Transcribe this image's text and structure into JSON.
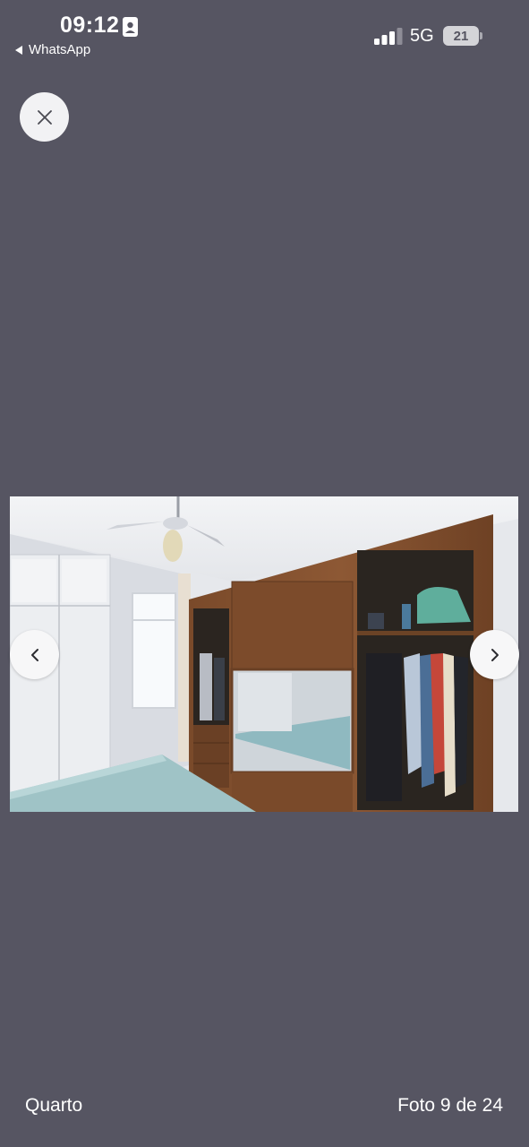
{
  "status_bar": {
    "time": "09:12",
    "back_app": "WhatsApp",
    "network": "5G",
    "battery": "21"
  },
  "icons": {
    "id_card": "contact-card-icon",
    "back": "back-triangle-icon",
    "signal": "cellular-signal-icon",
    "close": "close-icon",
    "prev": "chevron-left-icon",
    "next": "chevron-right-icon"
  },
  "gallery": {
    "photo_subject": "bedroom",
    "caption": "Quarto",
    "counter": "Foto 9 de 24",
    "current_photo": 9,
    "total_photos": 24
  }
}
